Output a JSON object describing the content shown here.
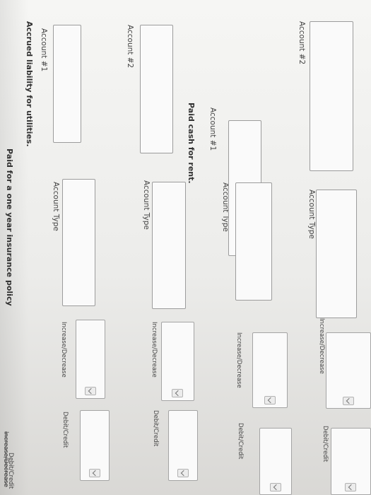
{
  "sections": [
    {
      "title": "Accrued liability for utilities.",
      "accounts": [
        "Account #1",
        "Account #2"
      ],
      "col_type": "Account Type",
      "col_inc": "Increase/Decrease",
      "col_dc": "Debit/Credit"
    },
    {
      "title": "Paid cash for rent.",
      "accounts": [
        "Account #1",
        "Account #2"
      ],
      "col_type": "Account Type",
      "col_inc": "Increase/Decrease",
      "col_dc": "Debit/Credit"
    },
    {
      "title": "Paid for a one year insurance policy",
      "col_inc": "Increase/Decrease",
      "col_dc": "Debit/Credit"
    }
  ],
  "colors": {
    "status_dot": "#e0392b"
  }
}
